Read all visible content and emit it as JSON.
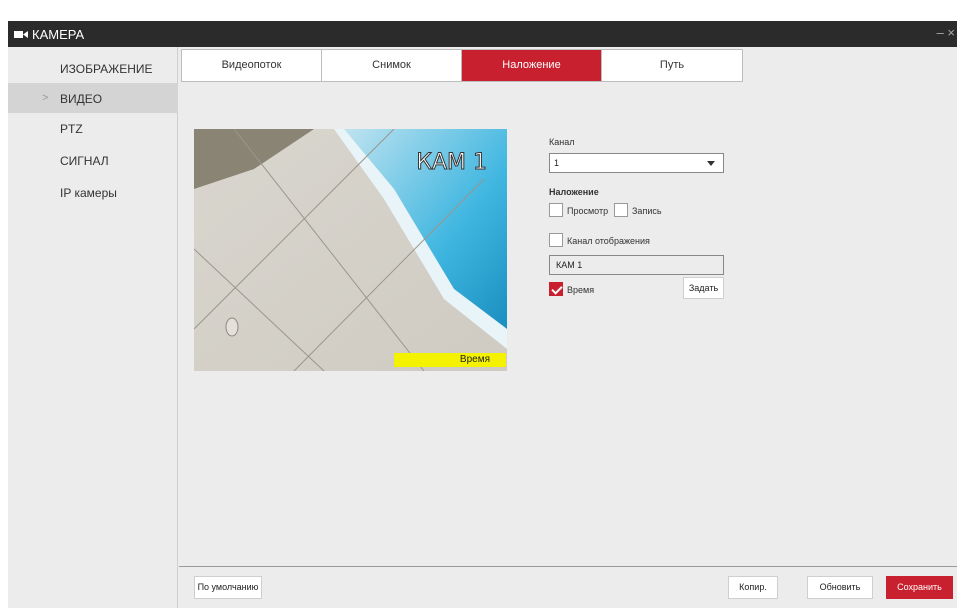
{
  "window": {
    "title": "КАМЕРА",
    "icon": "camera-icon",
    "controls": "– ×"
  },
  "sidebar": {
    "items": [
      {
        "label": "ИЗОБРАЖЕНИЕ"
      },
      {
        "label": "ВИДЕО",
        "active": true
      },
      {
        "label": "PTZ"
      },
      {
        "label": "СИГНАЛ"
      },
      {
        "label": "IP камеры"
      }
    ],
    "active_marker": ">"
  },
  "tabs": [
    {
      "label": "Видеопоток"
    },
    {
      "label": "Снимок"
    },
    {
      "label": "Наложение",
      "active": true
    },
    {
      "label": "Путь"
    }
  ],
  "preview": {
    "osd_name": "КАМ 1",
    "osd_time": "Время"
  },
  "form": {
    "channel_label": "Канал",
    "channel_value": "1",
    "overlay_label": "Наложение",
    "preview_label": "Просмотр",
    "record_label": "Запись",
    "channel_display_label": "Канал отображения",
    "channel_name_value": "КАМ 1",
    "time_label": "Время",
    "time_checked": true,
    "set_button": "Задать"
  },
  "footer": {
    "default_button": "По умолчанию",
    "copy_button": "Копир.",
    "refresh_button": "Обновить",
    "save_button": "Сохранить"
  },
  "colors": {
    "accent": "#c8202f",
    "titlebar": "#2b2b2b",
    "time_bg": "#f5f200"
  }
}
